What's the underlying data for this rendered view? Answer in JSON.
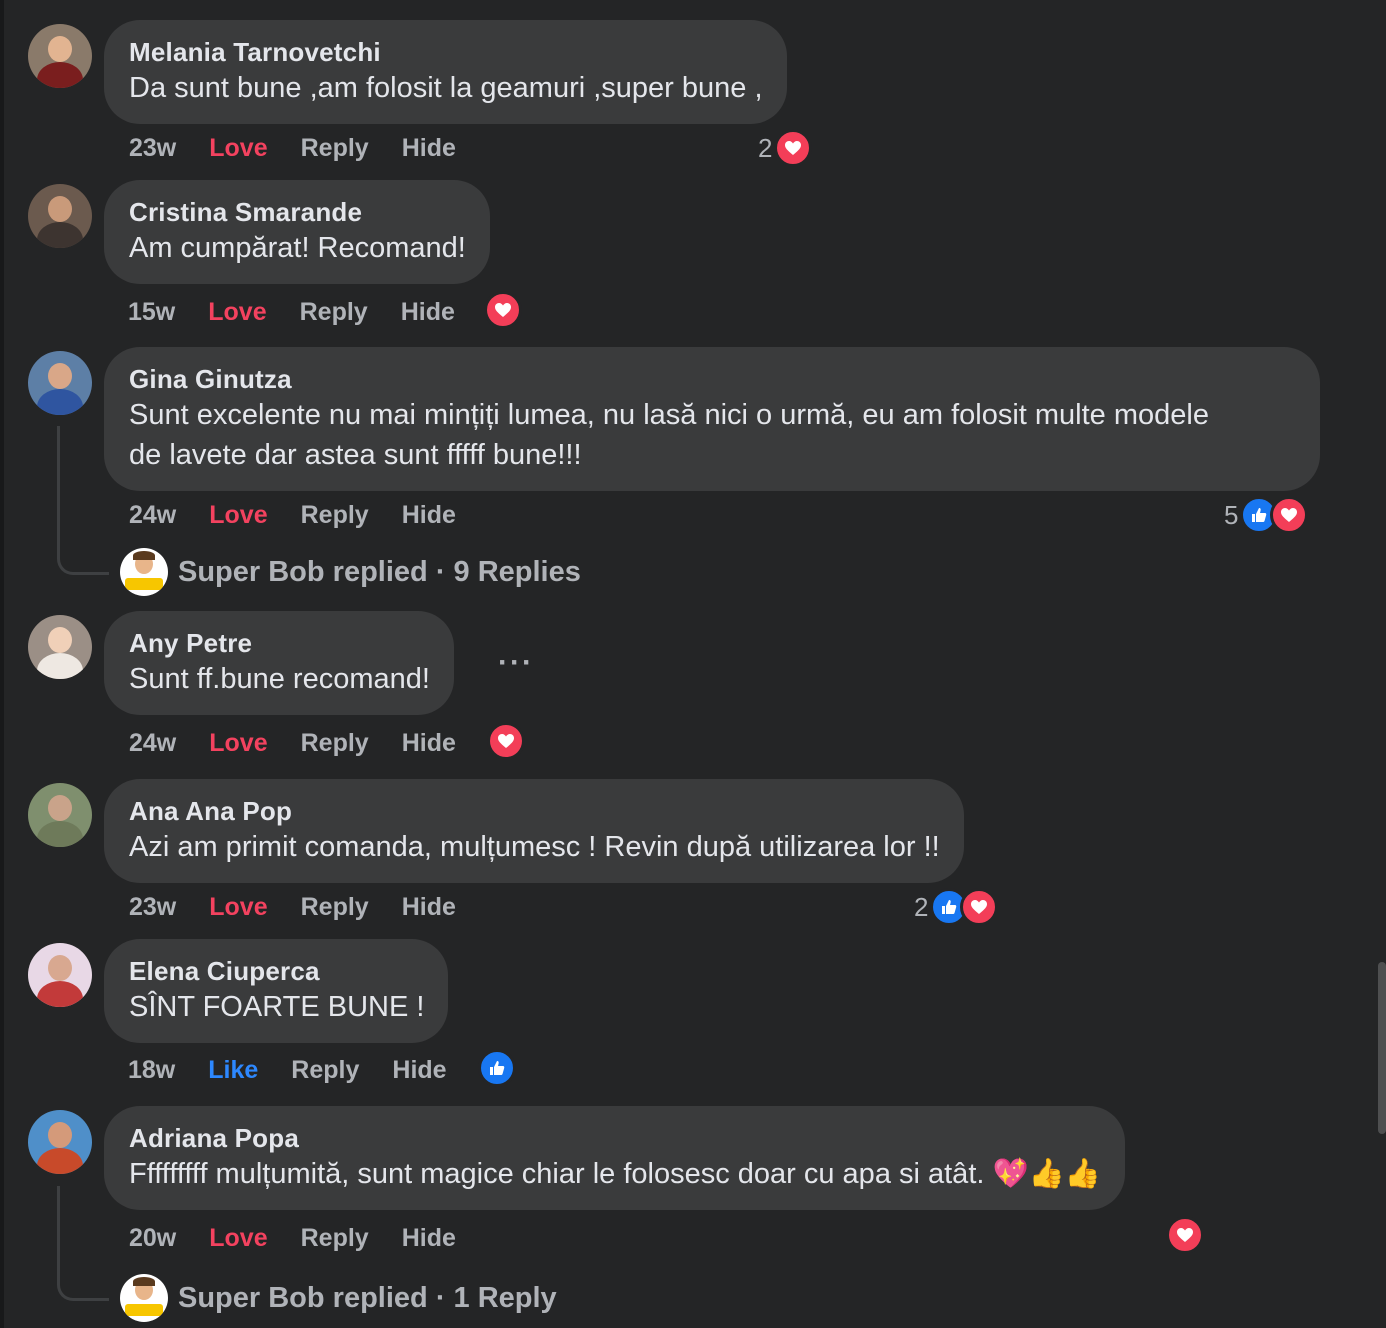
{
  "colors": {
    "background": "#242526",
    "bubble": "#3a3b3c",
    "love": "#f3425f",
    "like": "#2d88ff",
    "muted": "#b0b3b8"
  },
  "comments": [
    {
      "author": "Melania Tarnovetchi",
      "text": "Da sunt bune ,am folosit la geamuri ,super bune ,",
      "time": "23w",
      "reaction_label": "Love",
      "reply_label": "Reply",
      "hide_label": "Hide",
      "reaction_count": "2",
      "reaction_icons": [
        "heart-icon"
      ]
    },
    {
      "author": "Cristina Smarande",
      "text": "Am cumpărat! Recomand!",
      "time": "15w",
      "reaction_label": "Love",
      "reply_label": "Reply",
      "hide_label": "Hide",
      "reaction_count": "",
      "reaction_icons": [
        "heart-icon"
      ]
    },
    {
      "author": "Gina Ginutza",
      "text_line1": "Sunt excelente nu mai mințiți lumea, nu lasă nici o urmă, eu am folosit multe modele",
      "text_line2": "de lavete dar astea sunt fffff bune!!!",
      "time": "24w",
      "reaction_label": "Love",
      "reply_label": "Reply",
      "hide_label": "Hide",
      "reaction_count": "5",
      "reaction_icons": [
        "like-icon",
        "heart-icon"
      ],
      "replies_summary": "Super Bob replied · 9 Replies"
    },
    {
      "author": "Any Petre",
      "text": "Sunt ff.bune recomand!",
      "time": "24w",
      "reaction_label": "Love",
      "reply_label": "Reply",
      "hide_label": "Hide",
      "reaction_count": "",
      "reaction_icons": [
        "heart-icon"
      ],
      "more_label": "···"
    },
    {
      "author": "Ana Ana Pop",
      "text": "Azi am primit comanda, mulțumesc ! Revin după utilizarea lor !!",
      "time": "23w",
      "reaction_label": "Love",
      "reply_label": "Reply",
      "hide_label": "Hide",
      "reaction_count": "2",
      "reaction_icons": [
        "like-icon",
        "heart-icon"
      ]
    },
    {
      "author": "Elena Ciuperca",
      "text": "SÎNT FOARTE BUNE !",
      "time": "18w",
      "reaction_label": "Like",
      "reply_label": "Reply",
      "hide_label": "Hide",
      "reaction_count": "",
      "reaction_icons": [
        "like-icon"
      ]
    },
    {
      "author": "Adriana Popa",
      "text": "Fffffffff mulțumită, sunt magice chiar le folosesc doar cu apa si atât. 💖👍👍",
      "time": "20w",
      "reaction_label": "Love",
      "reply_label": "Reply",
      "hide_label": "Hide",
      "reaction_count": "",
      "reaction_icons": [
        "heart-icon"
      ],
      "replies_summary": "Super Bob replied · 1 Reply"
    }
  ]
}
